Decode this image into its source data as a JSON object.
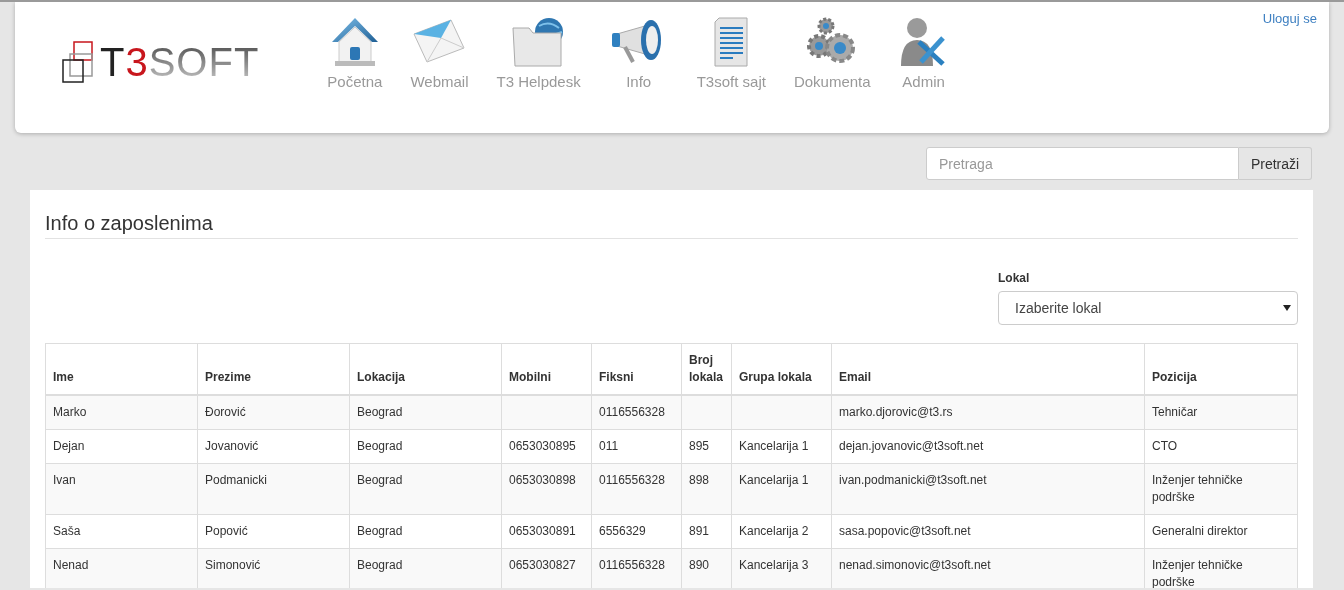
{
  "header": {
    "logo_parts": [
      "T",
      "3",
      "SOFT"
    ],
    "nav": [
      {
        "label": "Početna"
      },
      {
        "label": "Webmail"
      },
      {
        "label": "T3 Helpdesk"
      },
      {
        "label": "Info"
      },
      {
        "label": "T3soft sajt"
      },
      {
        "label": "Dokumenta"
      },
      {
        "label": "Admin"
      }
    ],
    "login_link": "Uloguj se"
  },
  "search": {
    "placeholder": "Pretraga",
    "button": "Pretraži"
  },
  "panel": {
    "title": "Info o zaposlenima",
    "filter_label": "Lokal",
    "filter_value": "Izaberite lokal",
    "table": {
      "columns": [
        "Ime",
        "Prezime",
        "Lokacija",
        "Mobilni",
        "Fiksni",
        "Broj lokala",
        "Grupa lokala",
        "Email",
        "Pozicija"
      ],
      "rows": [
        [
          "Marko",
          "Đorović",
          "Beograd",
          "",
          "0116556328",
          "",
          "",
          "marko.djorovic@t3.rs",
          "Tehničar"
        ],
        [
          "Dejan",
          "Jovanović",
          "Beograd",
          "0653030895",
          "011",
          "895",
          "Kancelarija 1",
          "dejan.jovanovic@t3soft.net",
          "CTO"
        ],
        [
          "Ivan",
          "Podmanicki",
          "Beograd",
          "0653030898",
          "0116556328",
          "898",
          "Kancelarija 1",
          "ivan.podmanicki@t3soft.net",
          "Inženjer tehničke podrške"
        ],
        [
          "Saša",
          "Popović",
          "Beograd",
          "0653030891",
          "6556329",
          "891",
          "Kancelarija 2",
          "sasa.popovic@t3soft.net",
          "Generalni direktor"
        ],
        [
          "Nenad",
          "Simonović",
          "Beograd",
          "0653030827",
          "0116556328",
          "890",
          "Kancelarija 3",
          "nenad.simonovic@t3soft.net",
          "Inženjer tehničke podrške"
        ]
      ]
    }
  }
}
